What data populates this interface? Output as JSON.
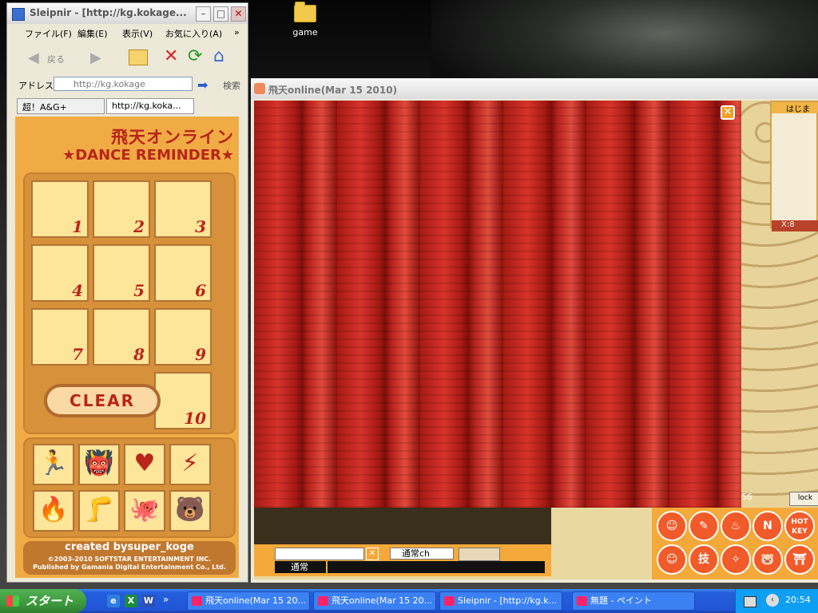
{
  "desktop": {
    "icon_label": "game"
  },
  "sleipnir": {
    "title": "Sleipnir - [http://kg.kokage...",
    "menu": [
      "ファイル(F)",
      "編集(E)",
      "表示(V)",
      "お気に入り(A)",
      "»"
    ],
    "back_label": "戻る",
    "address_label": "アドレス",
    "address_value": "http://kg.kokage",
    "search_label": "検索",
    "tabs": [
      "超！A&G+",
      "http://kg.koka..."
    ]
  },
  "dance": {
    "title1": "飛天オンライン",
    "title2": "★DANCE REMINDER★",
    "cells": [
      "1",
      "2",
      "3",
      "4",
      "5",
      "6",
      "7",
      "8",
      "9",
      "10"
    ],
    "clear_label": "CLEAR",
    "icons": [
      "🏃",
      "👹",
      "♥",
      "⚡",
      "🔥",
      "🦵",
      "🐙",
      "🐻"
    ],
    "credit1": "created bysuper_koge",
    "credit2": "©2003-2010 SOFTSTAR ENTERTAINMENT INC.",
    "credit3": "Published by Gamania Digital Entertainment Co., Ltd."
  },
  "game": {
    "title": "飛天online(Mar 15 2010)",
    "map_label": "はじま",
    "coord_label": "X:8",
    "channel": "通常ch",
    "chat_mode": "通常",
    "status_value": "56",
    "lock_label": "lock",
    "skills": [
      "☺",
      "✎",
      "♨",
      "N",
      "HOT KEY",
      "☺",
      "技",
      "✧",
      "🐷",
      "⛩"
    ]
  },
  "taskbar": {
    "start_label": "スタート",
    "tasks": [
      "飛天online(Mar 15 20...",
      "飛天online(Mar 15 20...",
      "Sleipnir - [http://kg.k...",
      "無題 - ペイント"
    ],
    "clock": "20:54"
  }
}
